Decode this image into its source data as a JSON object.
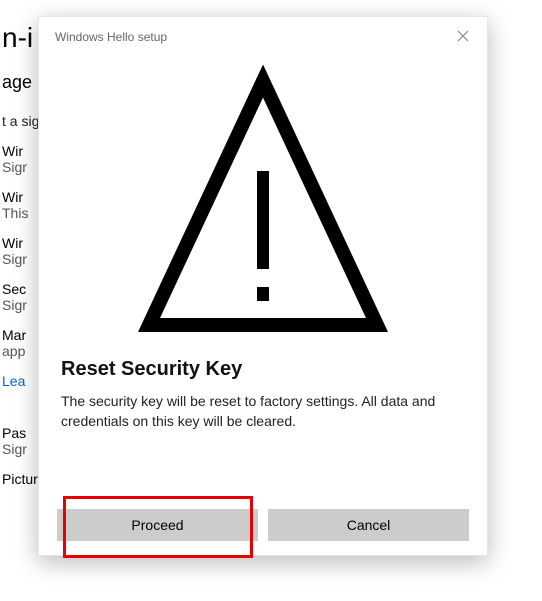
{
  "bg": {
    "page_title_fragment": "n-i",
    "subtitle_fragment": "age",
    "hint_fragment": "t a sig",
    "items": [
      {
        "line1": "Wir",
        "line2": "Sigr"
      },
      {
        "line1": "Wir",
        "line2": "This"
      },
      {
        "line1": "Wir",
        "line2": "Sigr"
      },
      {
        "line1": "Sec",
        "line2": "Sigr"
      },
      {
        "line1": "Mar",
        "line2": "app"
      }
    ],
    "link_fragment": "Lea",
    "password_item": {
      "line1": "Pas",
      "line2": "Sigr"
    },
    "picture_password": "Picture Password"
  },
  "dialog": {
    "title": "Windows Hello setup",
    "heading": "Reset Security Key",
    "body_text": "The security key will be reset to factory settings. All data and credentials on this key will be cleared.",
    "proceed_label": "Proceed",
    "cancel_label": "Cancel"
  }
}
